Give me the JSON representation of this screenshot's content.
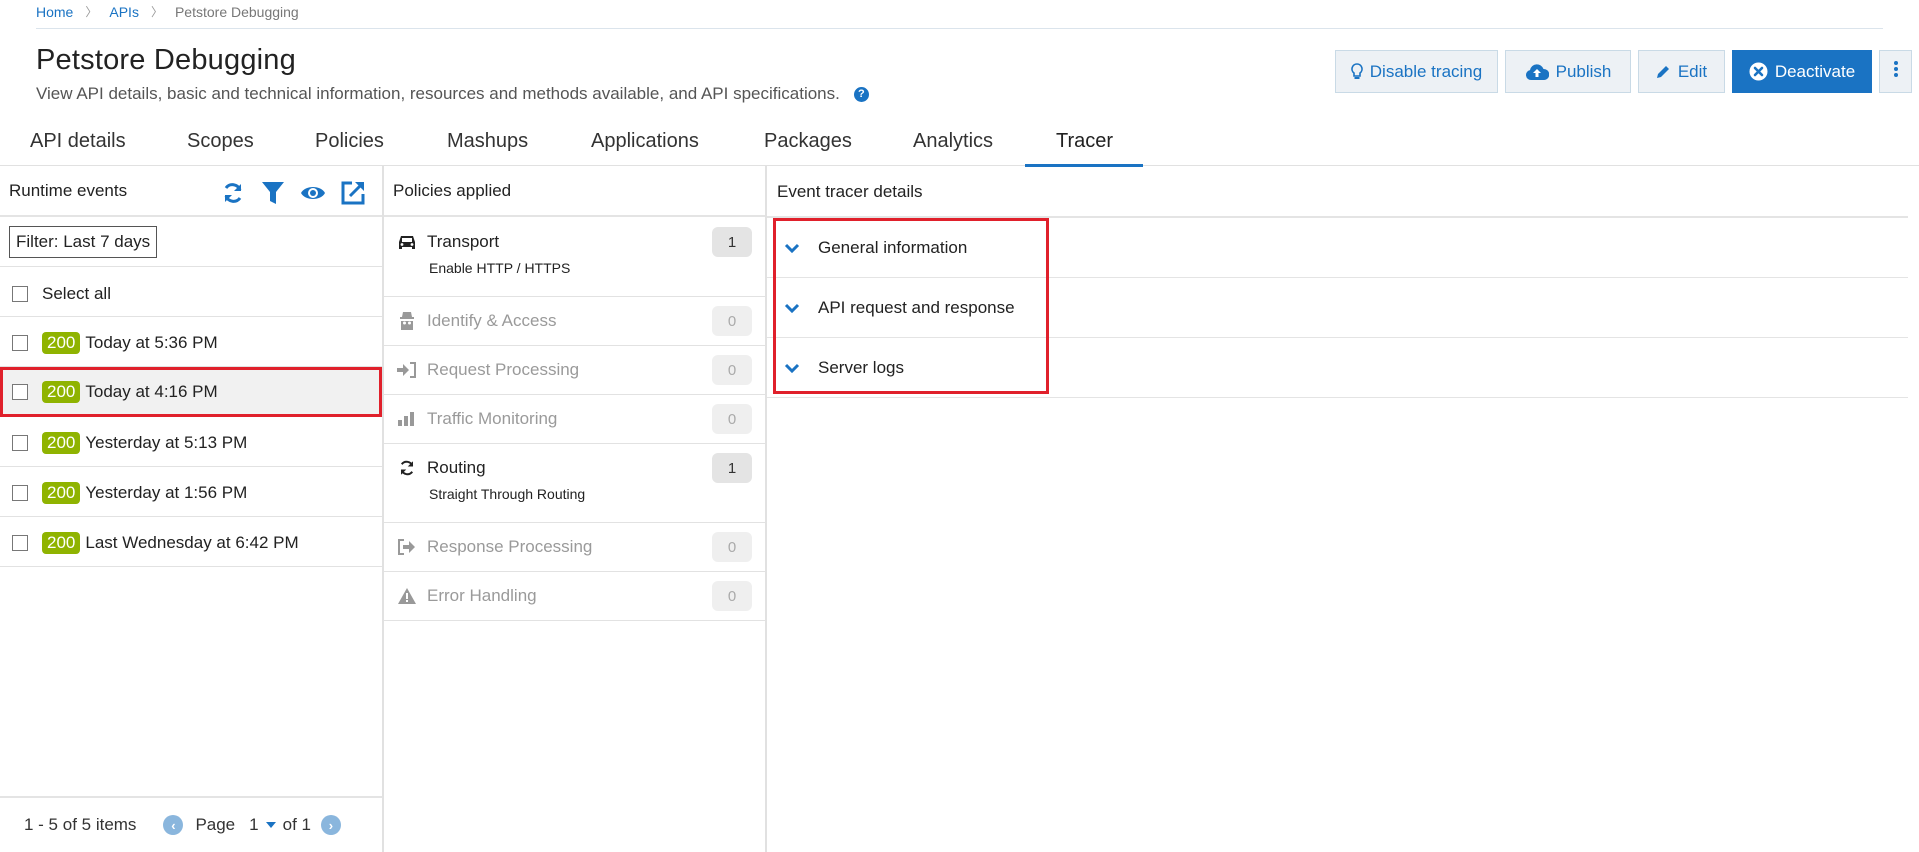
{
  "breadcrumb": {
    "items": [
      "Home",
      "APIs"
    ],
    "current": "Petstore Debugging",
    "separator": "〉"
  },
  "header": {
    "title": "Petstore Debugging",
    "description": "View API details, basic and technical information, resources and methods available, and API specifications.",
    "help_icon": "?"
  },
  "actions": {
    "disable_tracing": "Disable tracing",
    "publish": "Publish",
    "edit": "Edit",
    "deactivate": "Deactivate",
    "more": "more-vertical-icon"
  },
  "tabs": [
    {
      "label": "API details"
    },
    {
      "label": "Scopes"
    },
    {
      "label": "Policies"
    },
    {
      "label": "Mashups"
    },
    {
      "label": "Applications"
    },
    {
      "label": "Packages"
    },
    {
      "label": "Analytics"
    },
    {
      "label": "Tracer",
      "active": true
    }
  ],
  "runtime": {
    "title": "Runtime events",
    "icons": [
      "refresh-icon",
      "filter-icon",
      "eye-icon",
      "external-link-icon"
    ],
    "filter": "Filter: Last 7 days",
    "select_all": "Select all",
    "events": [
      {
        "status": "200",
        "time": "Today at 5:36 PM",
        "selected": false
      },
      {
        "status": "200",
        "time": "Today at 4:16 PM",
        "selected": true
      },
      {
        "status": "200",
        "time": "Yesterday at 5:13 PM",
        "selected": false
      },
      {
        "status": "200",
        "time": "Yesterday at 1:56 PM",
        "selected": false
      },
      {
        "status": "200",
        "time": "Last Wednesday at 6:42 PM",
        "selected": false
      }
    ],
    "pager": {
      "summary": "1 - 5 of 5 items",
      "page_word": "Page",
      "page": "1",
      "of": "of 1"
    },
    "status_color": "#8fb300"
  },
  "policies": {
    "title": "Policies applied",
    "items": [
      {
        "name": "Transport",
        "icon": "car-icon",
        "count": "1",
        "active": true,
        "sub": "Enable HTTP / HTTPS"
      },
      {
        "name": "Identify & Access",
        "icon": "spy-icon",
        "count": "0",
        "active": false
      },
      {
        "name": "Request Processing",
        "icon": "sign-in-icon",
        "count": "0",
        "active": false
      },
      {
        "name": "Traffic Monitoring",
        "icon": "bar-chart-icon",
        "count": "0",
        "active": false
      },
      {
        "name": "Routing",
        "icon": "refresh-icon",
        "count": "1",
        "active": true,
        "sub": "Straight Through Routing"
      },
      {
        "name": "Response Processing",
        "icon": "sign-out-icon",
        "count": "0",
        "active": false
      },
      {
        "name": "Error Handling",
        "icon": "warning-icon",
        "count": "0",
        "active": false
      }
    ]
  },
  "tracer": {
    "title": "Event tracer details",
    "sections": [
      {
        "label": "General information"
      },
      {
        "label": "API request and response"
      },
      {
        "label": "Server logs"
      }
    ]
  },
  "colors": {
    "accent": "#1a73c3",
    "highlight": "#e0202b",
    "status_ok": "#8fb300"
  }
}
